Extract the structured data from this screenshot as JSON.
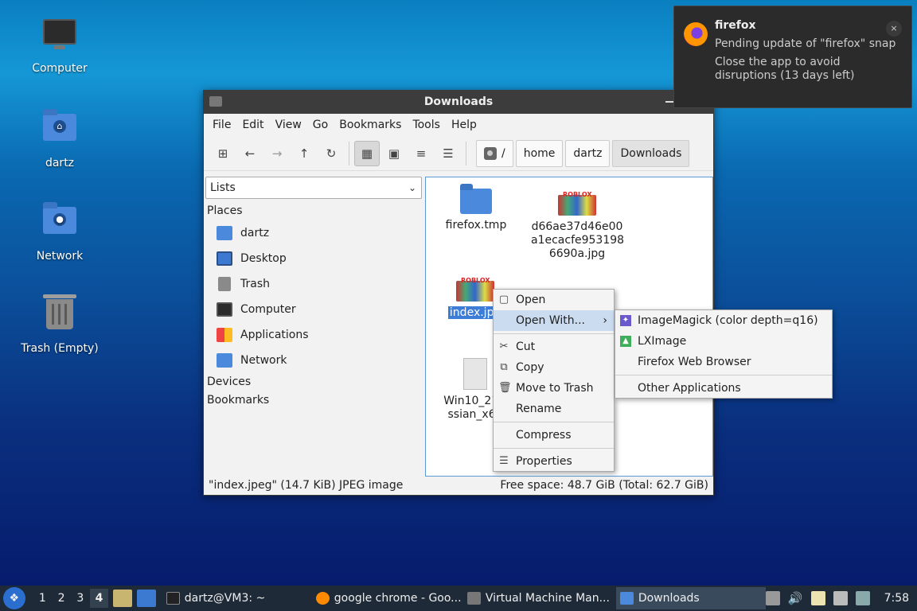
{
  "desktop": {
    "icons": [
      {
        "label": "Computer"
      },
      {
        "label": "dartz"
      },
      {
        "label": "Network"
      },
      {
        "label": "Trash (Empty)"
      }
    ]
  },
  "window": {
    "title": "Downloads",
    "menu": [
      "File",
      "Edit",
      "View",
      "Go",
      "Bookmarks",
      "Tools",
      "Help"
    ],
    "path": {
      "root": "/",
      "crumbs": [
        "home",
        "dartz",
        "Downloads"
      ]
    },
    "sidebar": {
      "mode": "Lists",
      "places_header": "Places",
      "places": [
        "dartz",
        "Desktop",
        "Trash",
        "Computer",
        "Applications",
        "Network"
      ],
      "devices_header": "Devices",
      "bookmarks_header": "Bookmarks"
    },
    "files": [
      {
        "name": "firefox.tmp"
      },
      {
        "name": "d66ae37d46e00 a1ecacfe953198 6690a.jpg"
      },
      {
        "name": "index.jpe"
      },
      {
        "name": "Win10_21H ssian_x64"
      }
    ],
    "status": {
      "left": "\"index.jpeg\" (14.7 KiB) JPEG image",
      "right": "Free space: 48.7 GiB (Total: 62.7 GiB)"
    }
  },
  "context_menu": {
    "items": [
      "Open",
      "Open With...",
      "Cut",
      "Copy",
      "Move to Trash",
      "Rename",
      "Compress",
      "Properties"
    ]
  },
  "submenu": {
    "items": [
      "ImageMagick (color depth=q16)",
      "LXImage",
      "Firefox Web Browser",
      "Other Applications"
    ]
  },
  "notification": {
    "app": "firefox",
    "line1": "Pending update of \"firefox\" snap",
    "line2": "Close the app to avoid disruptions (13 days left)",
    "close": "×"
  },
  "taskbar": {
    "workspaces": [
      "1",
      "2",
      "3",
      "4"
    ],
    "tasks": [
      "dartz@VM3: ~",
      "google chrome - Goo...",
      "Virtual Machine Man...",
      "Downloads"
    ],
    "clock": "7:58"
  }
}
